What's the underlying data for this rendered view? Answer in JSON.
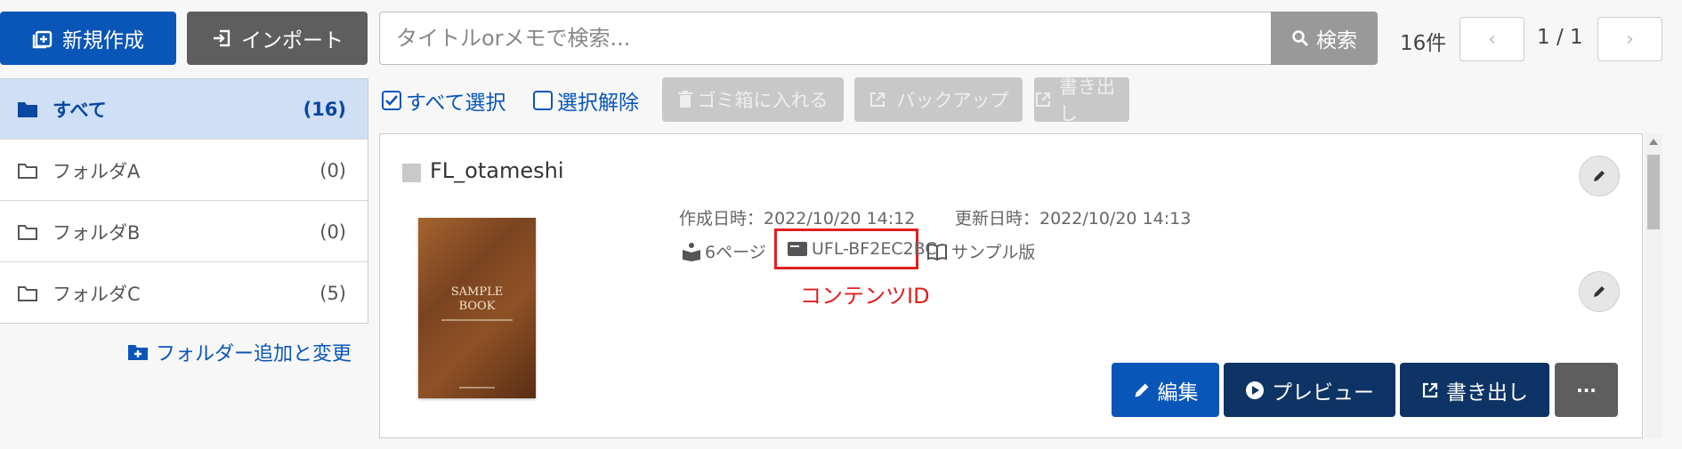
{
  "toolbar": {
    "new_label": "新規作成",
    "import_label": "インポート",
    "search_placeholder": "タイトルorメモで検索...",
    "search_button": "検索",
    "count": "16件",
    "prev": "‹",
    "page": "1 / 1",
    "next": "›"
  },
  "sidebar": {
    "items": [
      {
        "label": "すべて",
        "count": "(16)"
      },
      {
        "label": "フォルダA",
        "count": "(0)"
      },
      {
        "label": "フォルダB",
        "count": "(0)"
      },
      {
        "label": "フォルダC",
        "count": "(5)"
      }
    ],
    "add_folder": "フォルダー追加と変更"
  },
  "actions": {
    "select_all": "すべて選択",
    "deselect": "選択解除",
    "trash": "ゴミ箱に入れる",
    "backup": "バックアップ",
    "export": "書き出し"
  },
  "card": {
    "title": "FL_otameshi",
    "thumb_line1": "SAMPLE",
    "thumb_line2": "BOOK",
    "created": "作成日時：2022/10/20 14:12",
    "updated": "更新日時：2022/10/20 14:13",
    "pages": "6ページ",
    "content_id": "UFL-BF2EC2BC",
    "sample": "サンプル版",
    "annotation": "コンテンツID",
    "edit_label": "編集",
    "preview_label": "プレビュー",
    "export_label": "書き出し",
    "more_label": "···"
  },
  "colors": {
    "primary": "#0a56b8",
    "navy": "#0d3464",
    "annotation_red": "#e02020",
    "active_bg": "#cfdff5"
  }
}
